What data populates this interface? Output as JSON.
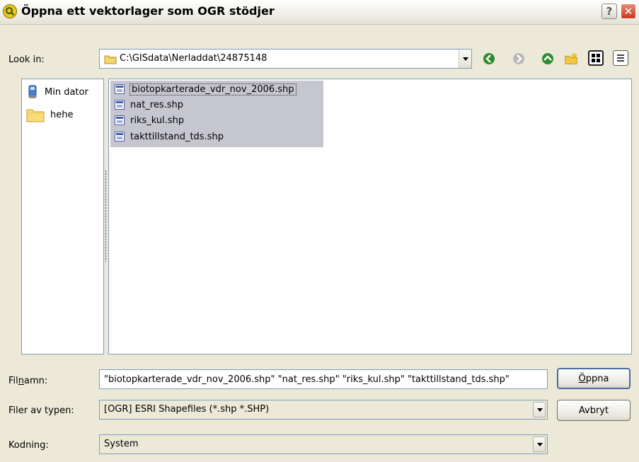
{
  "window": {
    "title": "Öppna ett vektorlager som OGR stödjer",
    "help_label": "?",
    "close_label": "✕"
  },
  "toolbar": {
    "look_in_label": "Look in:",
    "look_in_path": "C:\\GISdata\\Nerladdat\\24875148",
    "icons": [
      "back-icon",
      "forward-icon",
      "up-folder-icon",
      "new-folder-icon",
      "detail-view-icon",
      "list-view-icon"
    ]
  },
  "sidebar": {
    "items": [
      {
        "label": "Min dator",
        "icon": "computer-icon"
      },
      {
        "label": "hehe",
        "icon": "folder-icon"
      }
    ]
  },
  "files": [
    {
      "name": "biotopkarterade_vdr_nov_2006.shp",
      "selected": true,
      "focused": true
    },
    {
      "name": "nat_res.shp",
      "selected": true
    },
    {
      "name": "riks_kul.shp",
      "selected": true
    },
    {
      "name": "takttillstand_tds.shp",
      "selected": true
    }
  ],
  "form": {
    "filename_label_pre": "Fil",
    "filename_label_ul": "n",
    "filename_label_post": "amn:",
    "filename_value": "\"biotopkarterade_vdr_nov_2006.shp\" \"nat_res.shp\" \"riks_kul.shp\" \"takttillstand_tds.shp\"",
    "filetype_label": "Filer av typen:",
    "filetype_value": "[OGR] ESRI Shapefiles (*.shp *.SHP)",
    "encoding_label": "Kodning:",
    "encoding_value": "System"
  },
  "buttons": {
    "open_ul": "Ö",
    "open_rest": "ppna",
    "cancel": "Avbryt"
  },
  "colors": {
    "selection": "#c6c6d0",
    "window_bg": "#ece9d8",
    "close_red": "#c63a1e"
  }
}
